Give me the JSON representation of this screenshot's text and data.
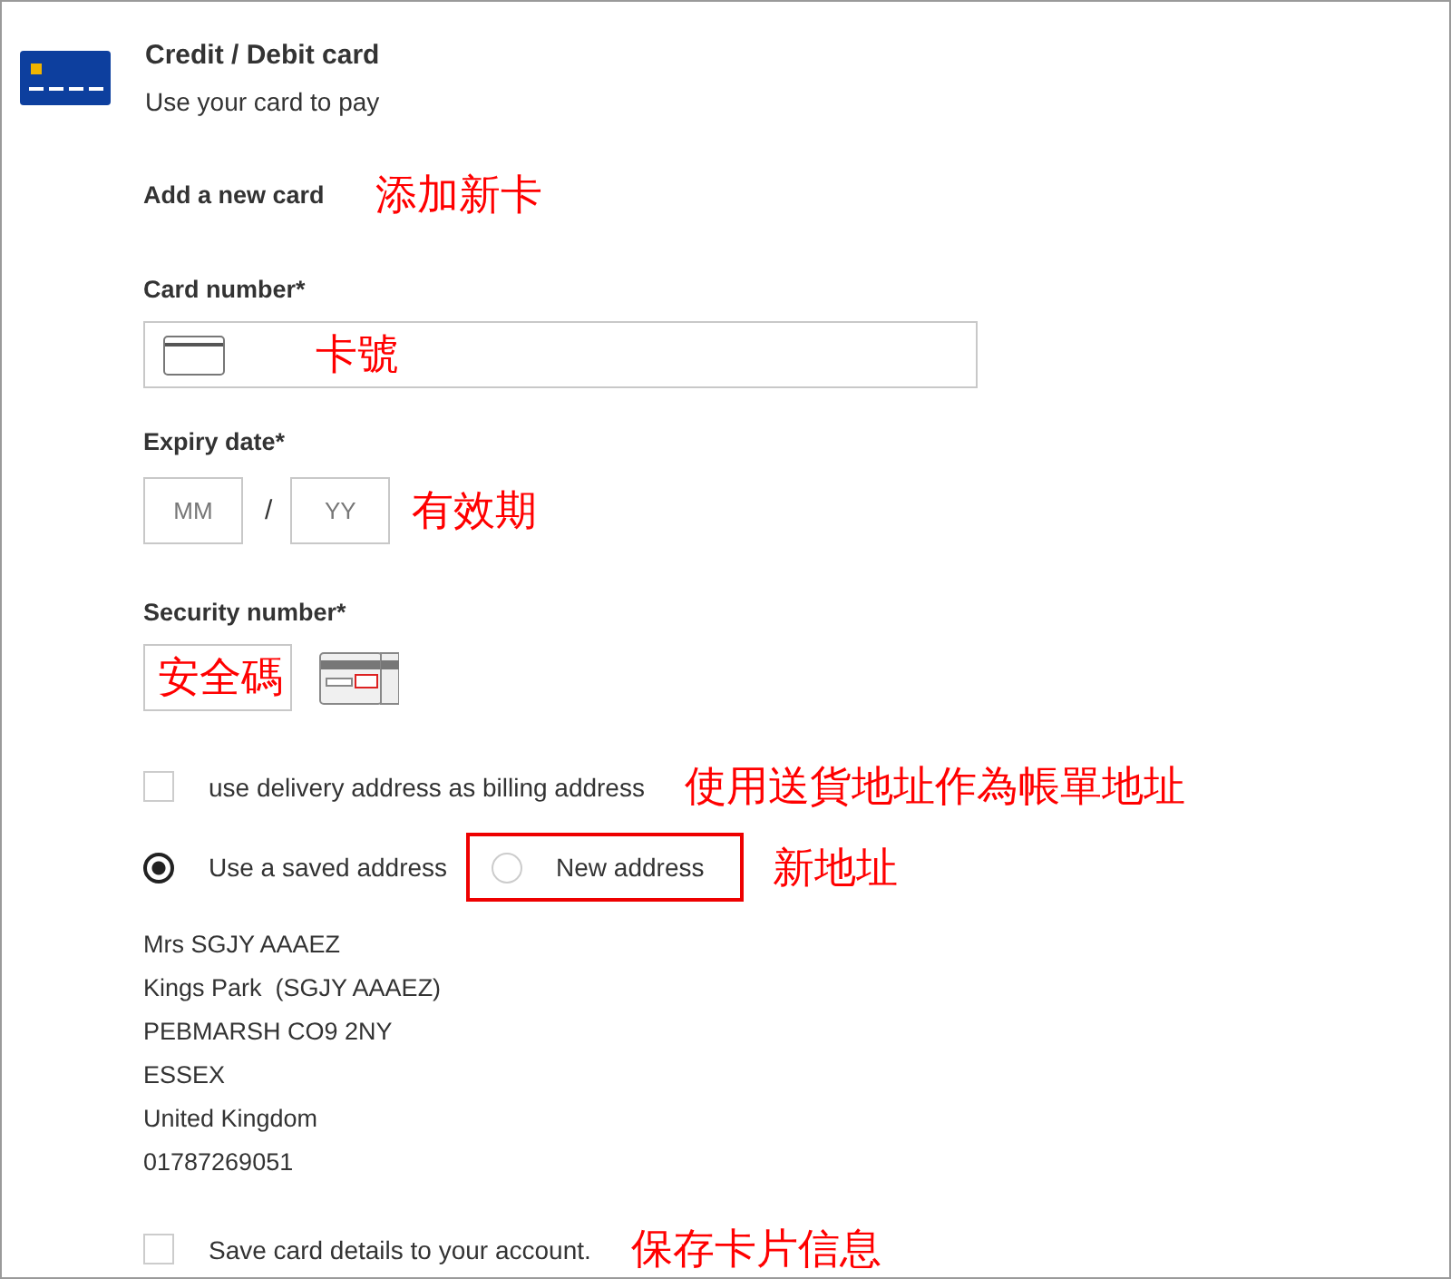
{
  "header": {
    "title": "Credit / Debit card",
    "subtitle": "Use your card to pay"
  },
  "add_card": {
    "label": "Add a new card",
    "annotation": "添加新卡"
  },
  "card_number": {
    "label": "Card number*",
    "annotation": "卡號"
  },
  "expiry": {
    "label": "Expiry date*",
    "month_placeholder": "MM",
    "separator": "/",
    "year_placeholder": "YY",
    "annotation": "有效期"
  },
  "security": {
    "label": "Security number*",
    "annotation": "安全碼"
  },
  "billing_checkbox": {
    "label": "use delivery address as billing address",
    "checked": false,
    "annotation": "使用送貨地址作為帳單地址"
  },
  "address_options": [
    {
      "label": "Use a saved address",
      "selected": true,
      "highlighted": false
    },
    {
      "label": "New address",
      "selected": false,
      "highlighted": true
    }
  ],
  "address_annotation": "新地址",
  "address_lines": [
    "Mrs SGJY AAAEZ",
    "Kings Park  (SGJY AAAEZ)",
    "PEBMARSH CO9 2NY",
    "ESSEX",
    "United Kingdom",
    "01787269051"
  ],
  "save_checkbox": {
    "label": "Save card details to your account.",
    "checked": false,
    "annotation": "保存卡片信息"
  }
}
